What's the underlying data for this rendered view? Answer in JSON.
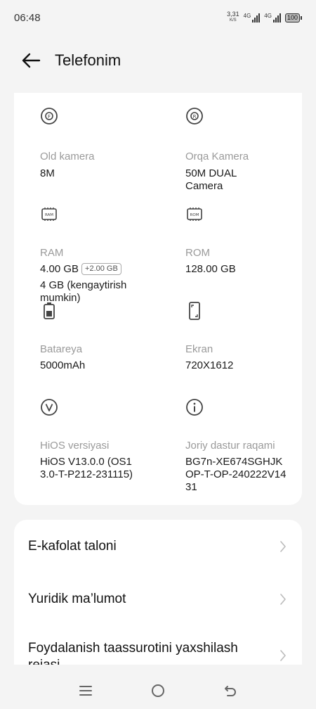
{
  "status_bar": {
    "time": "06:48",
    "speed_value": "3,31",
    "speed_unit": "K/S",
    "network_1": "4G",
    "network_2": "4G",
    "battery": "100"
  },
  "header": {
    "title": "Telefonim",
    "back_icon": "arrow-left-icon"
  },
  "specs": [
    {
      "icon": "front-camera-icon",
      "label": "Old kamera",
      "value": "8M"
    },
    {
      "icon": "rear-camera-icon",
      "label": "Orqa Kamera",
      "value": "50M DUAL Camera"
    },
    {
      "icon": "ram-chip-icon",
      "label": "RAM",
      "value": "4.00 GB",
      "badge": "+2.00 GB",
      "note": "4 GB (kengaytirish mumkin)"
    },
    {
      "icon": "rom-chip-icon",
      "label": "ROM",
      "value": "128.00 GB"
    },
    {
      "icon": "battery-icon",
      "label": "Batareya",
      "value": "5000mAh"
    },
    {
      "icon": "screen-icon",
      "label": "Ekran",
      "value": "720X1612"
    },
    {
      "icon": "hios-version-icon",
      "label": "HiOS versiyasi",
      "value": "HiOS V13.0.0 (OS13.0-T-P212-231115)"
    },
    {
      "icon": "info-icon",
      "label": "Joriy dastur raqami",
      "value": "BG7n-XE674SGHJKOP-T-OP-240222V1431"
    }
  ],
  "links": [
    {
      "label": "E-kafolat taloni"
    },
    {
      "label": "Yuridik ma’lumot"
    },
    {
      "label": "Foydalanish taassurotini yaxshilash rejasi"
    }
  ],
  "nav": {
    "menu_icon": "menu-icon",
    "home_icon": "home-icon",
    "back_icon": "back-icon"
  }
}
